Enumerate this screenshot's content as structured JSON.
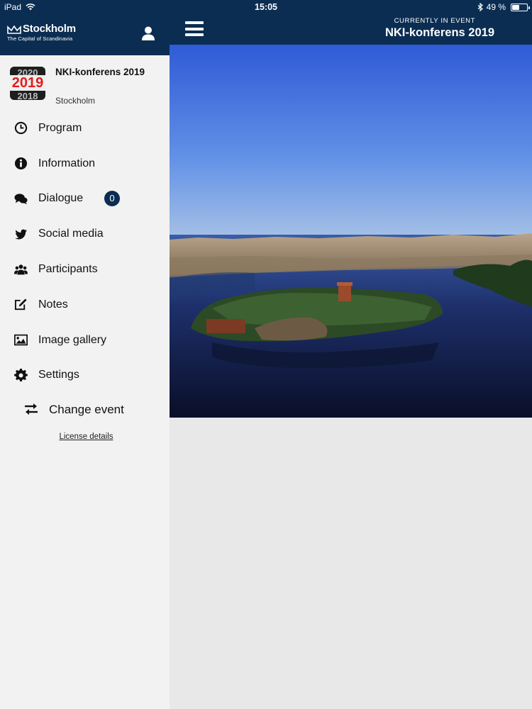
{
  "status": {
    "device": "iPad",
    "time": "15:05",
    "battery": "49 %",
    "battery_level": 0.49
  },
  "brand": {
    "name": "Stockholm",
    "tagline": "The Capital of Scandinavia"
  },
  "header": {
    "current_label": "CURRENTLY IN EVENT",
    "current_event": "NKI-konferens 2019"
  },
  "event": {
    "name": "NKI-konferens 2019",
    "city": "Stockholm",
    "logo_years": [
      "2020",
      "2019",
      "2018"
    ]
  },
  "menu": [
    {
      "label": "Program",
      "icon": "clock-icon"
    },
    {
      "label": "Information",
      "icon": "info-icon"
    },
    {
      "label": "Dialogue",
      "icon": "chat-icon",
      "badge": "0"
    },
    {
      "label": "Social media",
      "icon": "twitter-icon"
    },
    {
      "label": "Participants",
      "icon": "users-icon"
    },
    {
      "label": "Notes",
      "icon": "edit-icon"
    },
    {
      "label": "Image gallery",
      "icon": "image-icon"
    },
    {
      "label": "Settings",
      "icon": "gear-icon"
    }
  ],
  "change_event": {
    "label": "Change event",
    "icon": "swap-icon"
  },
  "license": "License details",
  "colors": {
    "navy": "#0b2d52",
    "sidebar_bg": "#f2f2f2",
    "content_bg": "#e8e8e8"
  }
}
